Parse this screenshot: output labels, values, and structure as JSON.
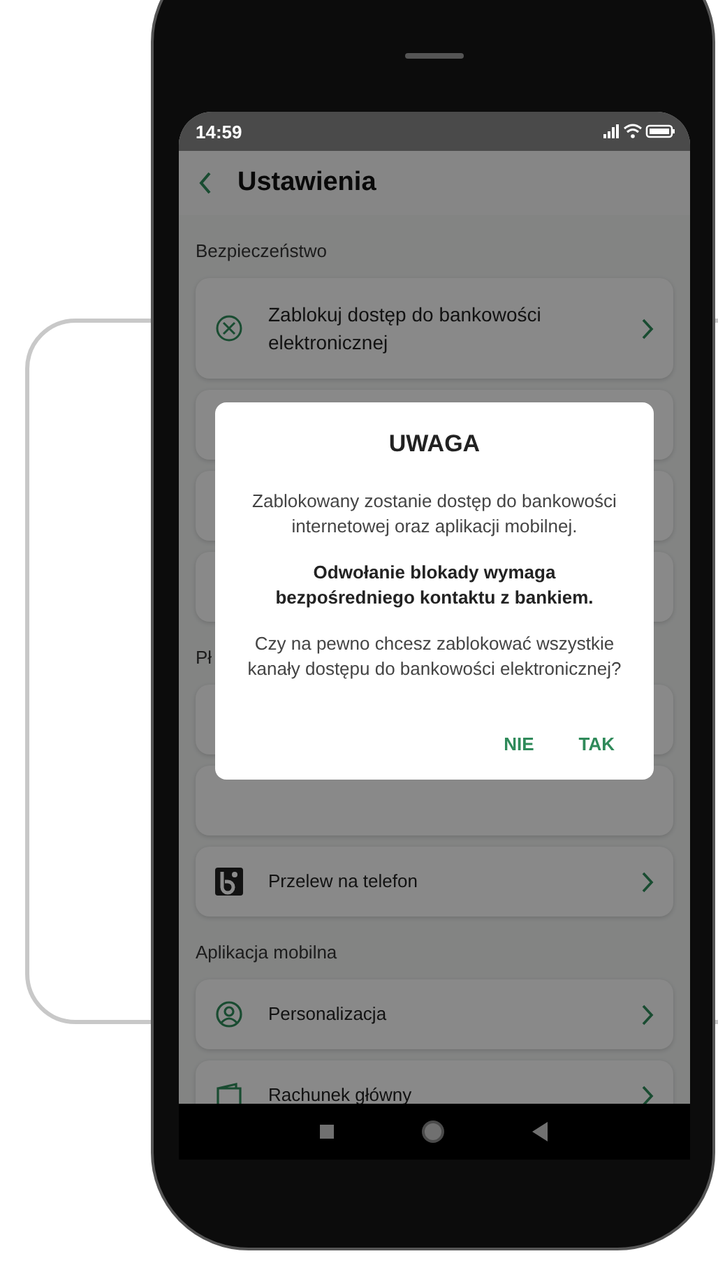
{
  "status_bar": {
    "time": "14:59"
  },
  "header": {
    "title": "Ustawienia"
  },
  "sections": [
    {
      "title": "Bezpieczeństwo",
      "items": [
        {
          "kind": "block",
          "label": "Zablokuj dostęp do bankowości elektronicznej"
        },
        {
          "kind": "covered"
        },
        {
          "kind": "covered"
        },
        {
          "kind": "covered"
        }
      ]
    },
    {
      "title": "Pł",
      "items": [
        {
          "kind": "covered"
        },
        {
          "kind": "covered"
        },
        {
          "kind": "blik",
          "label": "Przelew na telefon"
        }
      ]
    },
    {
      "title": "Aplikacja mobilna",
      "items": [
        {
          "kind": "user",
          "label": "Personalizacja"
        },
        {
          "kind": "wallet",
          "label": "Rachunek główny"
        }
      ]
    }
  ],
  "dialog": {
    "title": "UWAGA",
    "paragraphs": [
      {
        "kind": "normal",
        "text": "Zablokowany zostanie dostęp do bankowości internetowej oraz aplikacji mobilnej."
      },
      {
        "kind": "bold",
        "text": "Odwołanie blokady wymaga bezpośredniego kontaktu z bankiem."
      },
      {
        "kind": "normal",
        "text": "Czy na pewno chcesz zablokować wszystkie kanały dostępu do bankowości elektronicznej?"
      }
    ],
    "buttons": [
      "NIE",
      "TAK"
    ]
  }
}
